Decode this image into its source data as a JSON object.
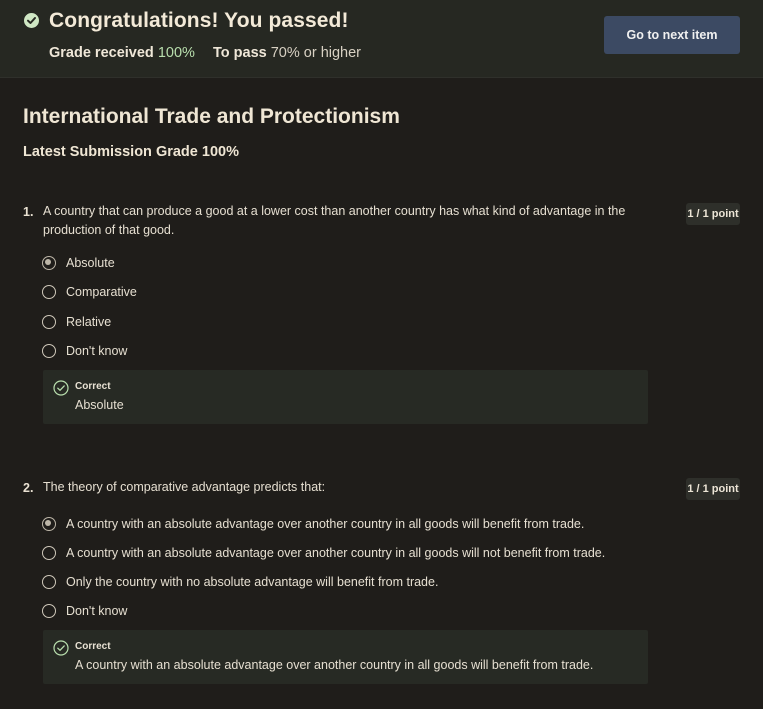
{
  "banner": {
    "title": "Congratulations! You passed!",
    "grade_label": "Grade received",
    "grade_value": "100%",
    "pass_label": "To pass",
    "pass_value": "70% or higher",
    "next_button": "Go to next item"
  },
  "quiz": {
    "title": "International Trade and Protectionism",
    "latest_submission": "Latest Submission Grade 100%"
  },
  "questions": [
    {
      "number": "1.",
      "text_line1": "A country that can produce a good at a lower cost than another country has what kind of advantage in the",
      "text_line2": "production of that good.",
      "points": "1 / 1 point",
      "options": [
        {
          "label": "Absolute",
          "selected": true
        },
        {
          "label": "Comparative",
          "selected": false
        },
        {
          "label": "Relative",
          "selected": false
        },
        {
          "label": "Don't know",
          "selected": false
        }
      ],
      "feedback_label": "Correct",
      "feedback_answer": "Absolute"
    },
    {
      "number": "2.",
      "text_line1": "The theory of comparative advantage predicts that:",
      "points": "1 / 1 point",
      "options": [
        {
          "label": "A country with an absolute advantage over another country in all goods will benefit from trade.",
          "selected": true
        },
        {
          "label": "A country with an absolute advantage over another country in all goods will not benefit from trade.",
          "selected": false
        },
        {
          "label": "Only the country with no absolute advantage will benefit from trade.",
          "selected": false
        },
        {
          "label": "Don't know",
          "selected": false
        }
      ],
      "feedback_label": "Correct",
      "feedback_answer": "A country with an absolute advantage over another country in all goods will benefit from trade."
    }
  ],
  "colors": {
    "background": "#1f1d1a",
    "banner": "#262822",
    "accent_button": "#3c4a63",
    "success_green": "#b9dfae",
    "feedback_bg": "#272a24"
  }
}
